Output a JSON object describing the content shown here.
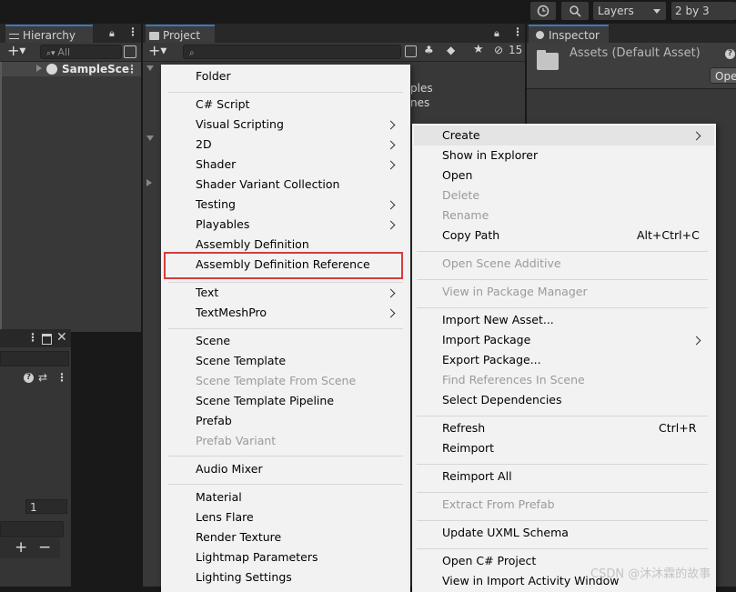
{
  "toolbar": {
    "layers_label": "Layers",
    "layout_label": "2 by 3"
  },
  "hierarchy": {
    "tab_label": "Hierarchy",
    "search_placeholder": "All",
    "scene_name": "SampleSce"
  },
  "project": {
    "tab_label": "Project",
    "visible_count": "15",
    "behind_text_1": "ples",
    "behind_text_2": "nes"
  },
  "inspector": {
    "tab_label": "Inspector",
    "asset_title": "Assets (Default Asset)",
    "open_button": "Ope"
  },
  "left_bottom_panel": {
    "number_field": "1"
  },
  "create_submenu": {
    "groups": [
      [
        "Folder"
      ],
      [
        "C# Script",
        "Visual Scripting",
        "2D",
        "Shader",
        "Shader Variant Collection",
        "Testing",
        "Playables",
        "Assembly Definition",
        "Assembly Definition Reference"
      ],
      [
        "Text",
        "TextMeshPro"
      ],
      [
        "Scene",
        "Scene Template",
        "Scene Template From Scene",
        "Scene Template Pipeline",
        "Prefab",
        "Prefab Variant"
      ],
      [
        "Audio Mixer"
      ],
      [
        "Material",
        "Lens Flare",
        "Render Texture",
        "Lightmap Parameters",
        "Lighting Settings"
      ]
    ],
    "highlighted_item": "Assembly Definition Reference"
  },
  "context_menu": {
    "create": "Create",
    "show_in_explorer": "Show in Explorer",
    "open": "Open",
    "delete": "Delete",
    "rename": "Rename",
    "copy_path": "Copy Path",
    "copy_path_shortcut": "Alt+Ctrl+C",
    "open_scene_additive": "Open Scene Additive",
    "view_in_package_manager": "View in Package Manager",
    "import_new_asset": "Import New Asset...",
    "import_package": "Import Package",
    "export_package": "Export Package...",
    "find_references": "Find References In Scene",
    "select_dependencies": "Select Dependencies",
    "refresh": "Refresh",
    "refresh_shortcut": "Ctrl+R",
    "reimport": "Reimport",
    "reimport_all": "Reimport All",
    "extract_from_prefab": "Extract From Prefab",
    "update_uxml_schema": "Update UXML Schema",
    "open_csharp_project": "Open C# Project",
    "view_in_import_activity": "View in Import Activity Window"
  },
  "watermark": "CSDN @沐沐霖的故事",
  "colors": {
    "editor_bg": "#383838",
    "menu_bg": "#f2f2f2",
    "highlight_border": "#d63c3c"
  }
}
